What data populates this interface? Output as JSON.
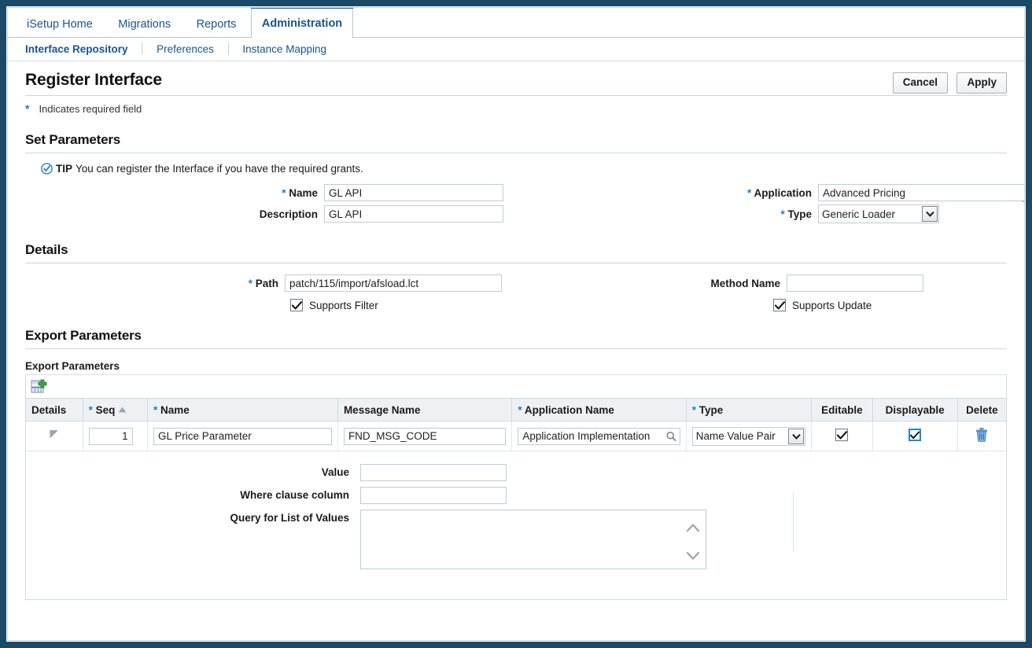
{
  "tabs": [
    {
      "label": "iSetup Home",
      "active": false
    },
    {
      "label": "Migrations",
      "active": false
    },
    {
      "label": "Reports",
      "active": false
    },
    {
      "label": "Administration",
      "active": true
    }
  ],
  "subtabs": [
    {
      "label": "Interface Repository",
      "active": true
    },
    {
      "label": "Preferences",
      "active": false
    },
    {
      "label": "Instance Mapping",
      "active": false
    }
  ],
  "page": {
    "title": "Register Interface",
    "required_note": "Indicates required field",
    "required_star": "*"
  },
  "actions": {
    "cancel_label": "Cancel",
    "apply_label": "Apply"
  },
  "set_parameters": {
    "heading": "Set Parameters",
    "tip_label": "TIP",
    "tip_text": "You can register the Interface if you have the required grants.",
    "name_label": "Name",
    "name_value": "GL API",
    "description_label": "Description",
    "description_value": "GL API",
    "application_label": "Application",
    "application_value": "Advanced Pricing",
    "type_label": "Type",
    "type_value": "Generic Loader",
    "type_options": [
      "Generic Loader"
    ]
  },
  "details": {
    "heading": "Details",
    "path_label": "Path",
    "path_value": "patch/115/import/afsload.lct",
    "supports_filter_label": "Supports Filter",
    "supports_filter_checked": true,
    "method_name_label": "Method Name",
    "method_name_value": "",
    "supports_update_label": "Supports Update",
    "supports_update_checked": true
  },
  "export_parameters": {
    "heading": "Export Parameters",
    "table_caption": "Export Parameters",
    "add_icon": "add-row-icon",
    "columns": [
      {
        "label": "Details",
        "required": false
      },
      {
        "label": "Seq",
        "required": true,
        "sort": "ascending"
      },
      {
        "label": "Name",
        "required": true
      },
      {
        "label": "Message Name",
        "required": false
      },
      {
        "label": "Application Name",
        "required": true
      },
      {
        "label": "Type",
        "required": true
      },
      {
        "label": "Editable",
        "required": false
      },
      {
        "label": "Displayable",
        "required": false
      },
      {
        "label": "Delete",
        "required": false
      }
    ],
    "rows": [
      {
        "expanded": true,
        "seq": "1",
        "name": "GL Price Parameter",
        "message_name": "FND_MSG_CODE",
        "application_name": "Application Implementation",
        "type": "Name Value Pair",
        "type_options": [
          "Name Value Pair"
        ],
        "editable": true,
        "editable_focused": false,
        "displayable": true,
        "displayable_focused": true,
        "delete_icon": "trash-icon"
      }
    ],
    "detail": {
      "value_label": "Value",
      "value": "",
      "where_clause_label": "Where clause column",
      "where_clause": "",
      "query_lov_label": "Query for List of Values",
      "query_lov": ""
    }
  },
  "colors": {
    "window_border": "#1b4a68",
    "link": "#19558c",
    "active_tab_bar": "#1565a8",
    "required_star": "#2a7ab9",
    "header_bg": "#eef1f4",
    "trash": "#4b87bd"
  }
}
